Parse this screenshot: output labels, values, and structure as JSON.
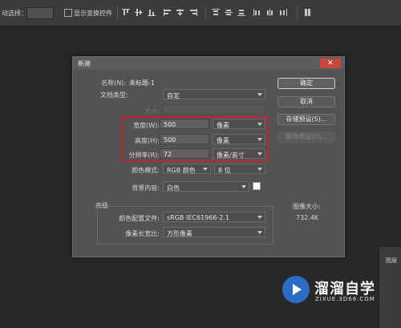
{
  "options_bar": {
    "auto_select_label": "动选择：",
    "layer_value": "",
    "show_transform_label": "显示变换控件",
    "align_icons": [
      "align-top-icon",
      "align-vcenter-icon",
      "align-bottom-icon",
      "align-left-icon",
      "align-hcenter-icon",
      "align-right-icon",
      "distribute-top-icon",
      "distribute-vcenter-icon",
      "distribute-bottom-icon",
      "distribute-left-icon",
      "distribute-hcenter-icon",
      "distribute-right-icon",
      "auto-align-icon"
    ]
  },
  "dialog": {
    "title": "新建",
    "close_symbol": "✕",
    "name_label": "名称(N):",
    "name_value": "未标题-1",
    "preset_label": "文档类型:",
    "preset_value": "自定",
    "size_label": "大小:",
    "width_label": "宽度(W):",
    "width_value": "500",
    "width_unit": "像素",
    "height_label": "高度(H):",
    "height_value": "500",
    "height_unit": "像素",
    "resolution_label": "分辨率(R):",
    "resolution_value": "72",
    "resolution_unit": "像素/英寸",
    "color_mode_label": "颜色模式:",
    "color_mode_value": "RGB 颜色",
    "bit_depth_value": "8 位",
    "background_label": "背景内容:",
    "background_value": "白色",
    "background_swatch_color": "#ffffff",
    "advanced_label": "高级",
    "color_profile_label": "颜色配置文件:",
    "color_profile_value": "sRGB IEC61966-2.1",
    "pixel_aspect_label": "像素长宽比:",
    "pixel_aspect_value": "方形像素",
    "buttons": {
      "ok": "确定",
      "cancel": "取消",
      "save_preset": "存储预设(S)...",
      "delete_preset": "删除预设(D)..."
    },
    "image_size_label": "图像大小:",
    "image_size_value": "732.4K"
  },
  "panel_tab": {
    "label": "图层"
  },
  "watermark": {
    "text": "溜溜自学",
    "url": "ZIXUE.3D66.COM",
    "accent": "#2b6cc4"
  },
  "highlight_color": "#c0272d"
}
